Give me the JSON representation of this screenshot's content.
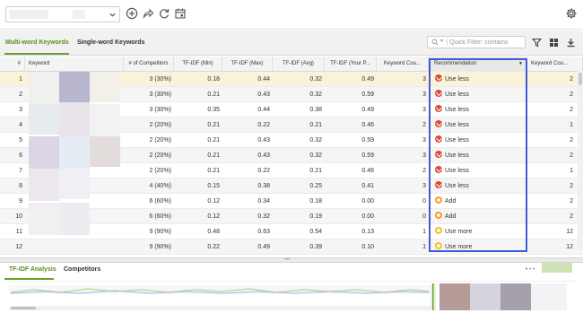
{
  "toolbar": {
    "project_select_value": "",
    "icons": [
      "add-circle-icon",
      "share-icon",
      "refresh-icon",
      "calendar-icon",
      "gear-icon"
    ]
  },
  "tabs": [
    {
      "label": "Multi-word Keywords",
      "active": true
    },
    {
      "label": "Single-word Keywords",
      "active": false
    }
  ],
  "quick_filter": {
    "placeholder": "Quick Filter: contains"
  },
  "grid": {
    "columns": [
      "#",
      "Keyword",
      "# of Competitors",
      "TF-IDF (Min)",
      "TF-IDF (Max)",
      "TF-IDF (Avg)",
      "TF-IDF (Your P...",
      "Keyword Cou...",
      "Recommendation",
      "Keyword Cou..."
    ],
    "rows": [
      {
        "num": "1",
        "competitors": "3 (30%)",
        "min": "0.18",
        "max": "0.44",
        "avg": "0.32",
        "yours": "0.49",
        "kw_count": "3",
        "rec": "Use less",
        "rec_type": "less",
        "kw_count2": "2"
      },
      {
        "num": "2",
        "competitors": "3 (30%)",
        "min": "0.21",
        "max": "0.43",
        "avg": "0.32",
        "yours": "0.59",
        "kw_count": "3",
        "rec": "Use less",
        "rec_type": "less",
        "kw_count2": "2"
      },
      {
        "num": "3",
        "competitors": "3 (30%)",
        "min": "0.35",
        "max": "0.44",
        "avg": "0.38",
        "yours": "0.49",
        "kw_count": "3",
        "rec": "Use less",
        "rec_type": "less",
        "kw_count2": "2"
      },
      {
        "num": "4",
        "competitors": "2 (20%)",
        "min": "0.21",
        "max": "0.22",
        "avg": "0.21",
        "yours": "0.46",
        "kw_count": "2",
        "rec": "Use less",
        "rec_type": "less",
        "kw_count2": "1"
      },
      {
        "num": "5",
        "competitors": "2 (20%)",
        "min": "0.21",
        "max": "0.43",
        "avg": "0.32",
        "yours": "0.59",
        "kw_count": "3",
        "rec": "Use less",
        "rec_type": "less",
        "kw_count2": "2"
      },
      {
        "num": "6",
        "competitors": "2 (20%)",
        "min": "0.21",
        "max": "0.43",
        "avg": "0.32",
        "yours": "0.59",
        "kw_count": "3",
        "rec": "Use less",
        "rec_type": "less",
        "kw_count2": "2"
      },
      {
        "num": "7",
        "competitors": "2 (20%)",
        "min": "0.21",
        "max": "0.22",
        "avg": "0.21",
        "yours": "0.46",
        "kw_count": "2",
        "rec": "Use less",
        "rec_type": "less",
        "kw_count2": "1"
      },
      {
        "num": "8",
        "competitors": "4 (40%)",
        "min": "0.15",
        "max": "0.38",
        "avg": "0.25",
        "yours": "0.41",
        "kw_count": "3",
        "rec": "Use less",
        "rec_type": "less",
        "kw_count2": "2"
      },
      {
        "num": "9",
        "competitors": "6 (60%)",
        "min": "0.12",
        "max": "0.34",
        "avg": "0.18",
        "yours": "0.00",
        "kw_count": "0",
        "rec": "Add",
        "rec_type": "add",
        "kw_count2": "2"
      },
      {
        "num": "10",
        "competitors": "6 (60%)",
        "min": "0.12",
        "max": "0.32",
        "avg": "0.19",
        "yours": "0.00",
        "kw_count": "0",
        "rec": "Add",
        "rec_type": "add",
        "kw_count2": "2"
      },
      {
        "num": "11",
        "competitors": "9 (90%)",
        "min": "0.48",
        "max": "0.63",
        "avg": "0.54",
        "yours": "0.13",
        "kw_count": "1",
        "rec": "Use more",
        "rec_type": "more",
        "kw_count2": "12"
      },
      {
        "num": "12",
        "competitors": "9 (90%)",
        "min": "0.22",
        "max": "0.49",
        "avg": "0.39",
        "yours": "0.10",
        "kw_count": "1",
        "rec": "Use more",
        "rec_type": "more",
        "kw_count2": "12"
      }
    ]
  },
  "bottom_tabs": [
    {
      "label": "TF-IDF Analysis",
      "active": true
    },
    {
      "label": "Competitors",
      "active": false
    }
  ],
  "colors": {
    "accent_green": "#6aa22f",
    "highlight_blue": "#4159d6",
    "use_less": "#d94c32",
    "add": "#f2a22a",
    "use_more": "#f2c12a",
    "selected_row": "#fbf3d9"
  }
}
